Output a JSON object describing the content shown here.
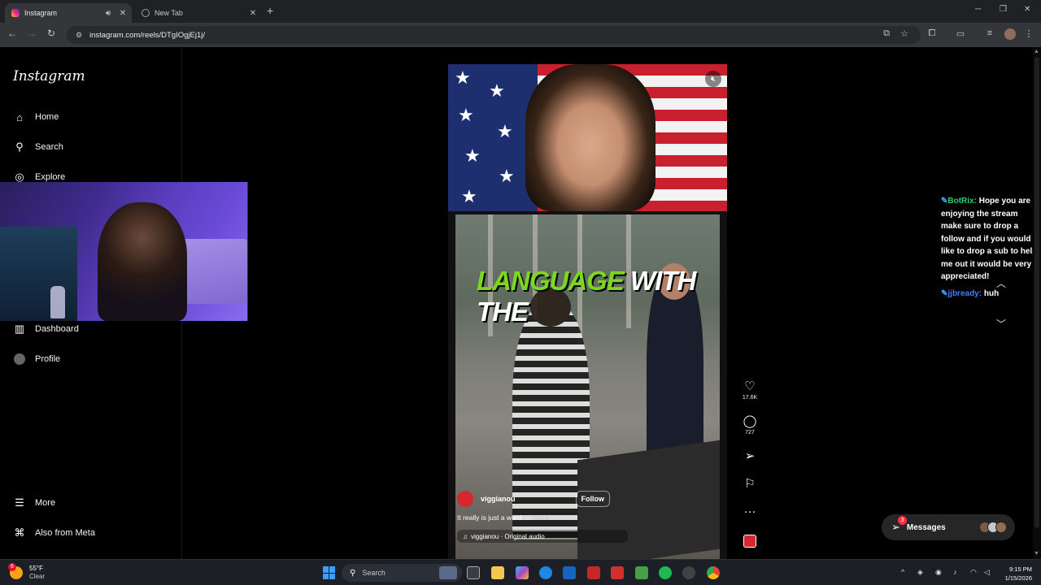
{
  "browser": {
    "tabs": [
      {
        "title": "Instagram",
        "active": true
      },
      {
        "title": "New Tab",
        "active": false
      }
    ],
    "url": "instagram.com/reels/DTgIOgjEj1j/"
  },
  "sidebar": {
    "logo": "Instagram",
    "items": [
      {
        "label": "Home",
        "icon": "home-icon"
      },
      {
        "label": "Search",
        "icon": "search-icon"
      },
      {
        "label": "Explore",
        "icon": "compass-icon"
      },
      {
        "label": "Dashboard",
        "icon": "dashboard-icon"
      },
      {
        "label": "Profile",
        "icon": "profile-icon"
      },
      {
        "label": "More",
        "icon": "menu-icon"
      },
      {
        "label": "Also from Meta",
        "icon": "meta-icon"
      }
    ]
  },
  "reel": {
    "caption_overlay": {
      "green": "LANGUAGE",
      "white": " WITH THE"
    },
    "author": "viggianou",
    "follow_label": "Follow",
    "description": "It really is just a word. ...",
    "more_label": "more",
    "audio": "viggianou · Original audio"
  },
  "actions": {
    "likes": "17.6K",
    "comments": "727"
  },
  "chat": {
    "msg1_user": "BotRix:",
    "msg1_text": " Hope you are enjoying the stream make sure to drop a follow and if you would like to drop a sub to help me out it would be very appreciated!",
    "msg2_user": "jjbready:",
    "msg2_text": " huh"
  },
  "messages": {
    "label": "Messages",
    "badge": "3"
  },
  "taskbar": {
    "temperature": "55°F",
    "condition": "Clear",
    "weather_badge": "6",
    "search_placeholder": "Search",
    "time": "9:15 PM",
    "date": "1/15/2026"
  },
  "colors": {
    "caption_green": "#7bd81f",
    "brand_red": "#d6262e",
    "notification_red": "#ff3040"
  }
}
